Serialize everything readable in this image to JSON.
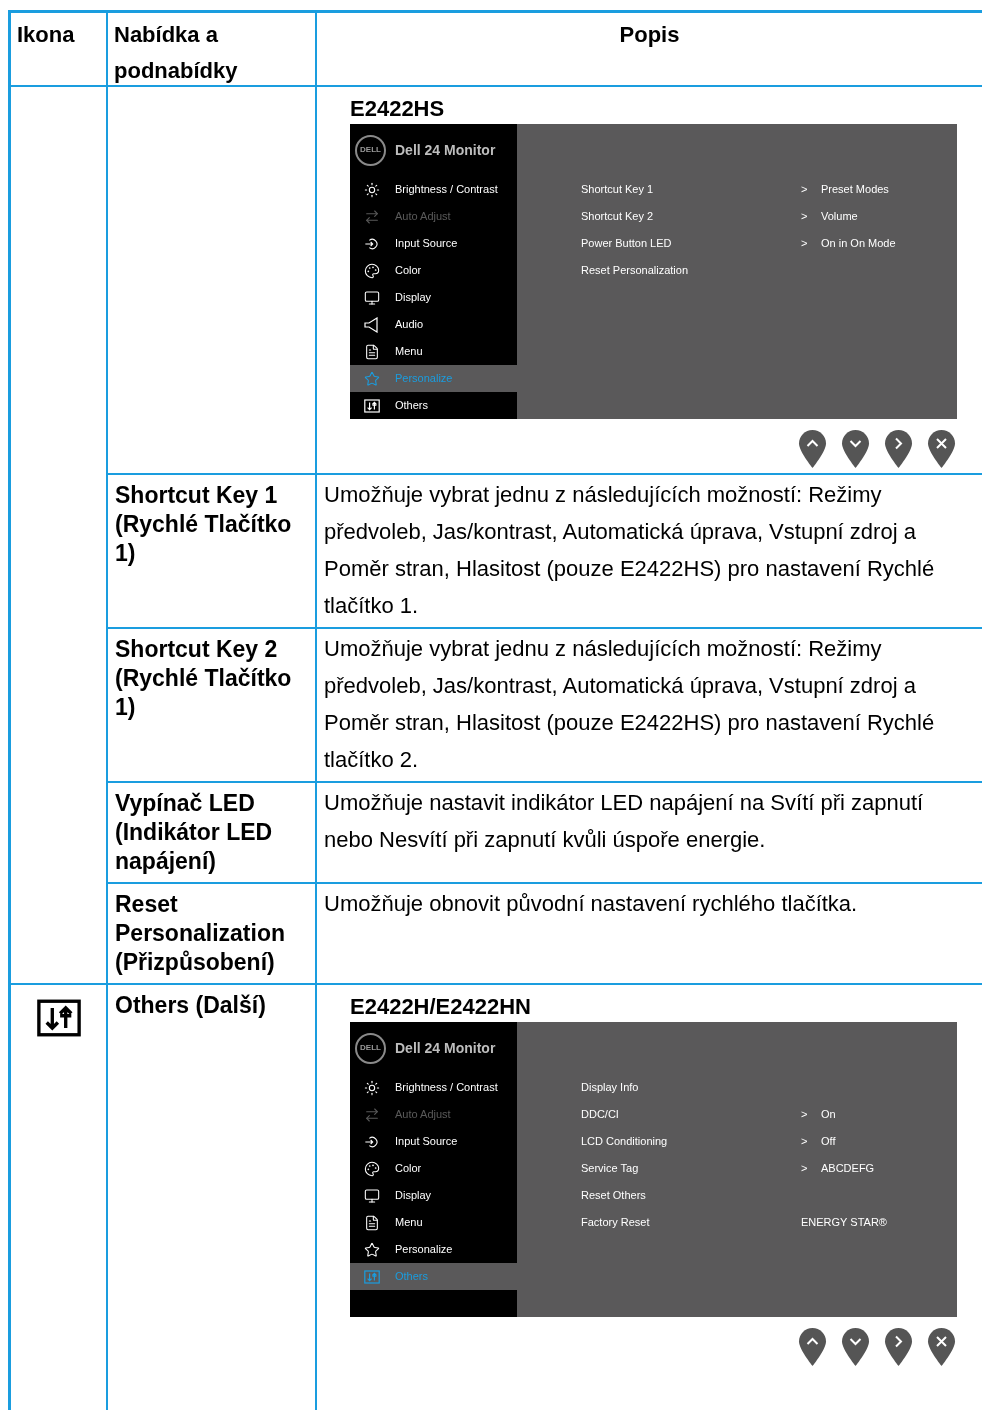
{
  "table": {
    "columns": [
      "Ikona",
      "Nabídka a podnabídky",
      "Popis"
    ],
    "sections": [
      {
        "icon_shown": false,
        "rows": [
          {
            "kind": "osd",
            "osd": {
              "model": "E2422HS",
              "logo": "DELL",
              "title": "Dell 24 Monitor",
              "menu": [
                {
                  "kind": "brightness",
                  "label": "Brightness / Contrast",
                  "disabled": false,
                  "selected": false
                },
                {
                  "kind": "auto",
                  "label": "Auto Adjust",
                  "disabled": true,
                  "selected": false
                },
                {
                  "kind": "input",
                  "label": "Input Source",
                  "disabled": false,
                  "selected": false
                },
                {
                  "kind": "color",
                  "label": "Color",
                  "disabled": false,
                  "selected": false
                },
                {
                  "kind": "display",
                  "label": "Display",
                  "disabled": false,
                  "selected": false
                },
                {
                  "kind": "audio",
                  "label": "Audio",
                  "disabled": false,
                  "selected": false
                },
                {
                  "kind": "menu",
                  "label": "Menu",
                  "disabled": false,
                  "selected": false
                },
                {
                  "kind": "personalize",
                  "label": "Personalize",
                  "disabled": false,
                  "selected": true
                },
                {
                  "kind": "others",
                  "label": "Others",
                  "disabled": false,
                  "selected": false
                }
              ],
              "options": [
                {
                  "label": "Shortcut Key 1",
                  "marker": ">",
                  "value": "Preset Modes"
                },
                {
                  "label": "Shortcut Key 2",
                  "marker": ">",
                  "value": "Volume"
                },
                {
                  "label": "Power Button LED",
                  "marker": ">",
                  "value": "On in On Mode"
                },
                {
                  "label": "Reset Personalization"
                }
              ]
            }
          },
          {
            "kind": "text",
            "menu": "Shortcut Key 1 (Rychlé Tlačítko 1)",
            "description": "Umožňuje vybrat jednu z následujících možností: Režimy předvoleb, Jas/kontrast, Automatická úprava, Vstupní zdroj a Poměr stran, Hlasitost (pouze E2422HS) pro nastavení Rychlé tlačítko 1."
          },
          {
            "kind": "text",
            "menu": "Shortcut Key 2 (Rychlé Tlačítko 1)",
            "description": "Umožňuje vybrat jednu z následujících možností: Režimy předvoleb, Jas/kontrast, Automatická úprava, Vstupní zdroj a Poměr stran, Hlasitost (pouze E2422HS) pro nastavení Rychlé tlačítko 2."
          },
          {
            "kind": "text",
            "menu": "Vypínač LED (Indikátor LED napájení)",
            "description": "Umožňuje nastavit indikátor LED napájení na Svítí při zapnutí nebo Nesvítí při zapnutí kvůli úspoře energie."
          },
          {
            "kind": "text",
            "menu": "Reset Personalization (Přizpůsobení)",
            "description": "Umožňuje obnovit původní nastavení rychlého tlačítka."
          }
        ]
      },
      {
        "icon_shown": true,
        "rows": [
          {
            "kind": "osd",
            "menu": "Others (Další)",
            "osd": {
              "model": "E2422H/E2422HN",
              "logo": "DELL",
              "title": "Dell 24 Monitor",
              "menu": [
                {
                  "kind": "brightness",
                  "label": "Brightness / Contrast",
                  "disabled": false,
                  "selected": false
                },
                {
                  "kind": "auto",
                  "label": "Auto Adjust",
                  "disabled": true,
                  "selected": false
                },
                {
                  "kind": "input",
                  "label": "Input Source",
                  "disabled": false,
                  "selected": false
                },
                {
                  "kind": "color",
                  "label": "Color",
                  "disabled": false,
                  "selected": false
                },
                {
                  "kind": "display",
                  "label": "Display",
                  "disabled": false,
                  "selected": false
                },
                {
                  "kind": "menu",
                  "label": "Menu",
                  "disabled": false,
                  "selected": false
                },
                {
                  "kind": "personalize",
                  "label": "Personalize",
                  "disabled": false,
                  "selected": false
                },
                {
                  "kind": "others",
                  "label": "Others",
                  "disabled": false,
                  "selected": true
                }
              ],
              "options": [
                {
                  "label": "Display Info"
                },
                {
                  "label": "DDC/CI",
                  "marker": ">",
                  "value": "On"
                },
                {
                  "label": "LCD Conditioning",
                  "marker": ">",
                  "value": "Off"
                },
                {
                  "label": "Service Tag",
                  "marker": ">",
                  "value": "ABCDEFG"
                },
                {
                  "label": "Reset Others"
                },
                {
                  "label": "Factory Reset",
                  "value": "ENERGY STAR®"
                }
              ]
            }
          }
        ]
      }
    ]
  }
}
